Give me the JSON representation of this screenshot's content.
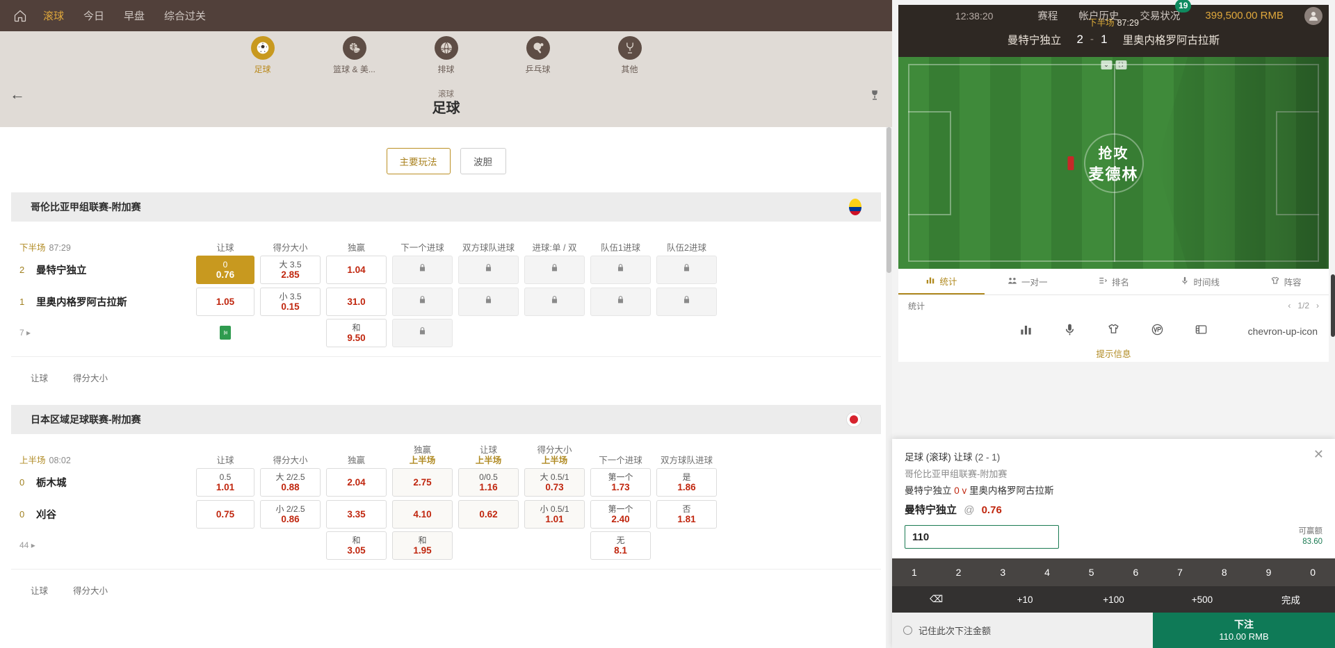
{
  "header": {
    "home_icon": "home-icon",
    "nav": [
      {
        "label": "滚球",
        "active": true
      },
      {
        "label": "今日",
        "active": false
      },
      {
        "label": "早盘",
        "active": false
      },
      {
        "label": "综合过关",
        "active": false
      }
    ],
    "clock": "12:38:20",
    "right_nav": [
      {
        "label": "赛程",
        "badge": ""
      },
      {
        "label": "帐户历史",
        "badge": ""
      },
      {
        "label": "交易状况",
        "badge": "19"
      }
    ],
    "balance": "399,500.00 RMB",
    "avatar_icon": "user-avatar-icon"
  },
  "sports": [
    {
      "label": "足球",
      "icon": "soccer-ball-icon",
      "active": true
    },
    {
      "label": "篮球 & 美...",
      "icon": "basketball-icon",
      "active": false
    },
    {
      "label": "排球",
      "icon": "volleyball-icon",
      "active": false
    },
    {
      "label": "乒乓球",
      "icon": "table-tennis-icon",
      "active": false
    },
    {
      "label": "其他",
      "icon": "other-sports-icon",
      "active": false
    }
  ],
  "title_band": {
    "back_icon": "arrow-left-icon",
    "subtitle": "滚球",
    "title": "足球",
    "trophy_icon": "trophy-icon"
  },
  "filters": [
    {
      "label": "主要玩法",
      "active": true
    },
    {
      "label": "波胆",
      "active": false
    }
  ],
  "leagues": [
    {
      "name": "哥伦比亚甲组联赛-附加赛",
      "flag": "flag-colombia",
      "columns": [
        "让球",
        "得分大小",
        "独赢",
        "下一个进球",
        "双方球队进球",
        "进球:单 / 双",
        "队伍1进球",
        "队伍2进球"
      ],
      "column_sub": [
        "",
        "",
        "",
        "",
        "",
        "",
        "",
        ""
      ],
      "phase": "下半场",
      "clock": "87:29",
      "rows": [
        {
          "score": "2",
          "team": "曼特宁独立",
          "cells": [
            {
              "line": "0",
              "odd": "0.76",
              "state": "selected"
            },
            {
              "line": "大 3.5",
              "odd": "2.85",
              "state": "open"
            },
            {
              "line": "",
              "odd": "1.04",
              "state": "open"
            },
            {
              "state": "locked"
            },
            {
              "state": "locked"
            },
            {
              "state": "locked"
            },
            {
              "state": "locked"
            },
            {
              "state": "locked"
            }
          ]
        },
        {
          "score": "1",
          "team": "里奥内格罗阿古拉斯",
          "cells": [
            {
              "line": "",
              "odd": "1.05",
              "state": "open"
            },
            {
              "line": "小 3.5",
              "odd": "0.15",
              "state": "open"
            },
            {
              "line": "",
              "odd": "31.0",
              "state": "open"
            },
            {
              "state": "locked"
            },
            {
              "state": "locked"
            },
            {
              "state": "locked"
            },
            {
              "state": "locked"
            },
            {
              "state": "locked"
            }
          ]
        },
        {
          "score": "",
          "team": "",
          "index": "7",
          "stream": true,
          "cells": [
            {
              "state": "empty"
            },
            {
              "state": "empty"
            },
            {
              "line": "和",
              "odd": "9.50",
              "state": "open"
            },
            {
              "state": "locked"
            },
            {
              "state": "empty"
            },
            {
              "state": "empty"
            },
            {
              "state": "empty"
            },
            {
              "state": "empty"
            }
          ]
        }
      ],
      "bottom_links": [
        "让球",
        "得分大小"
      ]
    },
    {
      "name": "日本区域足球联赛-附加赛",
      "flag": "flag-japan",
      "columns": [
        "让球",
        "得分大小",
        "独赢",
        "独赢",
        "让球",
        "得分大小",
        "下一个进球",
        "双方球队进球"
      ],
      "column_sub": [
        "",
        "",
        "",
        "上半场",
        "上半场",
        "上半场",
        "",
        ""
      ],
      "phase": "上半场",
      "clock": "08:02",
      "rows": [
        {
          "score": "0",
          "team": "栃木城",
          "cells": [
            {
              "line": "0.5",
              "odd": "1.01",
              "state": "open"
            },
            {
              "line": "大 2/2.5",
              "odd": "0.88",
              "state": "open"
            },
            {
              "line": "",
              "odd": "2.04",
              "state": "open"
            },
            {
              "line": "",
              "odd": "2.75",
              "state": "tinted"
            },
            {
              "line": "0/0.5",
              "odd": "1.16",
              "state": "tinted"
            },
            {
              "line": "大 0.5/1",
              "odd": "0.73",
              "state": "tinted"
            },
            {
              "line": "第一个",
              "odd": "1.73",
              "state": "open"
            },
            {
              "line": "是",
              "odd": "1.86",
              "state": "open"
            }
          ]
        },
        {
          "score": "0",
          "team": "刈谷",
          "cells": [
            {
              "line": "",
              "odd": "0.75",
              "state": "open"
            },
            {
              "line": "小 2/2.5",
              "odd": "0.86",
              "state": "open"
            },
            {
              "line": "",
              "odd": "3.35",
              "state": "open"
            },
            {
              "line": "",
              "odd": "4.10",
              "state": "tinted"
            },
            {
              "line": "",
              "odd": "0.62",
              "state": "tinted"
            },
            {
              "line": "小 0.5/1",
              "odd": "1.01",
              "state": "tinted"
            },
            {
              "line": "第一个",
              "odd": "2.40",
              "state": "open"
            },
            {
              "line": "否",
              "odd": "1.81",
              "state": "open"
            }
          ]
        },
        {
          "score": "",
          "team": "",
          "index": "44",
          "stream": false,
          "cells": [
            {
              "state": "empty"
            },
            {
              "state": "empty"
            },
            {
              "line": "和",
              "odd": "3.05",
              "state": "open"
            },
            {
              "line": "和",
              "odd": "1.95",
              "state": "tinted"
            },
            {
              "state": "empty"
            },
            {
              "state": "empty"
            },
            {
              "line": "无",
              "odd": "8.1",
              "state": "open"
            },
            {
              "state": "empty"
            }
          ]
        }
      ],
      "bottom_links": [
        "让球",
        "得分大小"
      ]
    }
  ],
  "video": {
    "phase": "下半场",
    "clock": "87:29",
    "home_team": "曼特宁独立",
    "home_score": "2",
    "separator": "-",
    "away_score": "1",
    "away_team": "里奥内格罗阿古拉斯",
    "overlay_line1": "抢攻",
    "overlay_line2": "麦德林",
    "control_expand": "⌄",
    "control_fullscreen": "⛶"
  },
  "stat_tabs": [
    {
      "label": "统计",
      "icon": "bar-chart-icon",
      "active": true
    },
    {
      "label": "一对一",
      "icon": "head-to-head-icon",
      "active": false
    },
    {
      "label": "排名",
      "icon": "ranking-icon",
      "active": false
    },
    {
      "label": "时间线",
      "icon": "timeline-icon",
      "active": false
    },
    {
      "label": "阵容",
      "icon": "lineup-icon",
      "active": false
    }
  ],
  "stat_sub": {
    "label": "统计",
    "page": "1/2",
    "prev_icon": "chevron-left-icon",
    "next_icon": "chevron-right-icon"
  },
  "stat_icons": [
    {
      "name": "bar-chart-icon"
    },
    {
      "name": "microphone-icon"
    },
    {
      "name": "shirt-icon"
    },
    {
      "name": "versus-icon"
    },
    {
      "name": "scoreboard-icon"
    }
  ],
  "stat_collapse_icon": "chevron-up-icon",
  "tip_line": "提示信息",
  "bet_slip": {
    "close_icon": "close-icon",
    "market": "足球 (滚球) 让球",
    "market_score": "(2 - 1)",
    "league": "哥伦比亚甲组联赛-附加赛",
    "fixture_home": "曼特宁独立",
    "fixture_mid": "0 v",
    "fixture_away": "里奥内格罗阿古拉斯",
    "selection": "曼特宁独立",
    "at_symbol": "@",
    "odds": "0.76",
    "stake_value": "110",
    "stake_placeholder": "",
    "winnings_label": "可赢额",
    "winnings_amount": "83.60",
    "num_keys": [
      "1",
      "2",
      "3",
      "4",
      "5",
      "6",
      "7",
      "8",
      "9",
      "0"
    ],
    "action_keys": [
      {
        "label": "⌫",
        "name": "backspace-key"
      },
      {
        "label": "+10",
        "name": "plus-10-key"
      },
      {
        "label": "+100",
        "name": "plus-100-key"
      },
      {
        "label": "+500",
        "name": "plus-500-key"
      },
      {
        "label": "完成",
        "name": "done-key"
      }
    ],
    "remember_label": "记住此次下注金额",
    "place_label": "下注",
    "place_amount": "110.00 RMB"
  },
  "colors": {
    "brand_brown": "#51403a",
    "accent_gold": "#c8991f",
    "odds_red": "#c0260e",
    "place_green": "#0f7a57",
    "badge_green": "#0f8a5f"
  }
}
